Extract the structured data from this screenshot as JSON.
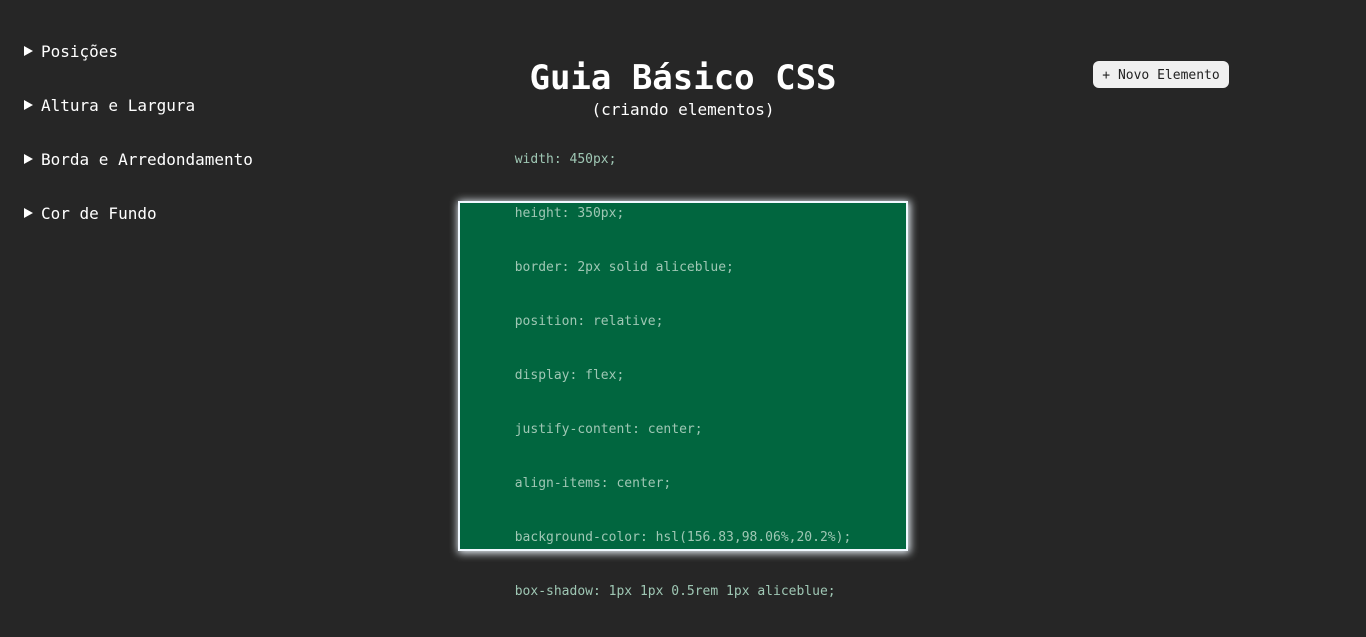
{
  "sidebar": {
    "items": [
      {
        "label": "Posições"
      },
      {
        "label": "Altura e Largura"
      },
      {
        "label": "Borda e Arredondamento"
      },
      {
        "label": "Cor de Fundo"
      }
    ]
  },
  "header": {
    "title": "Guia Básico CSS",
    "subtitle": "(criando elementos)"
  },
  "toolbar": {
    "new_element_label": "+ Novo Elemento"
  },
  "box": {
    "code_lines": [
      "width: 450px;",
      "height: 350px;",
      "border: 2px solid aliceblue;",
      "position: relative;",
      "display: flex;",
      "justify-content: center;",
      "align-items: center;",
      "background-color: hsl(156.83,98.06%,20.2%);",
      "box-shadow: 1px 1px 0.5rem 1px aliceblue;"
    ]
  },
  "colors": {
    "page_background": "#262626",
    "box_background": "#006641",
    "box_border": "aliceblue"
  }
}
